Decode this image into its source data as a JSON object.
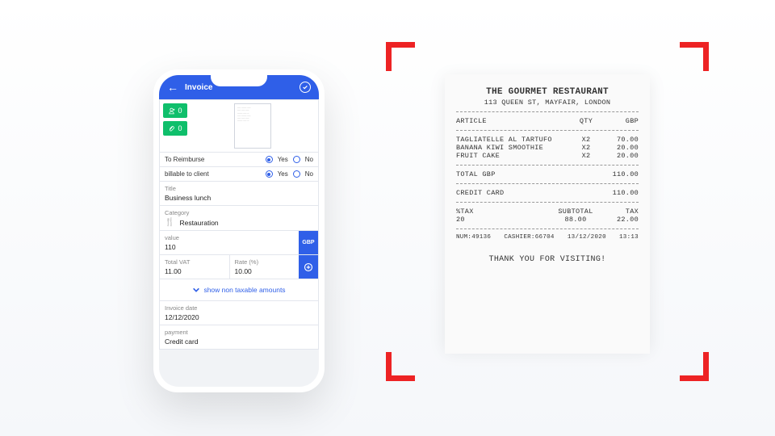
{
  "phone": {
    "header": {
      "title": "Invoice"
    },
    "counters": {
      "people": "0",
      "attachments": "0"
    },
    "reimburse": {
      "label": "To Reimburse",
      "yes": "Yes",
      "no": "No",
      "selected": "yes"
    },
    "billable": {
      "label": "billable to client",
      "yes": "Yes",
      "no": "No",
      "selected": "yes"
    },
    "title": {
      "label": "Title",
      "value": "Business lunch"
    },
    "category": {
      "label": "Category",
      "value": "Restauration"
    },
    "value": {
      "label": "value",
      "amount": "110",
      "currency": "GBP"
    },
    "vat": {
      "total_label": "Total VAT",
      "total_value": "11.00",
      "rate_label": "Rate (%)",
      "rate_value": "10.00"
    },
    "show_non_taxable": "show non taxable amounts",
    "invoice_date": {
      "label": "Invoice date",
      "value": "12/12/2020"
    },
    "payment": {
      "label": "payment",
      "value": "Credit card"
    }
  },
  "receipt": {
    "name": "THE GOURMET RESTAURANT",
    "address": "113 QUEEN ST, MAYFAIR, LONDON",
    "cols": {
      "article": "ARTICLE",
      "qty": "QTY",
      "cur": "GBP"
    },
    "items": [
      {
        "name": "TAGLIATELLE AL TARTUFO",
        "qty": "X2",
        "price": "70.00"
      },
      {
        "name": "BANANA KIWI SMOOTHIE",
        "qty": "X2",
        "price": "20.00"
      },
      {
        "name": "FRUIT CAKE",
        "qty": "X2",
        "price": "20.00"
      }
    ],
    "total": {
      "label": "TOTAL GBP",
      "value": "110.00"
    },
    "payment": {
      "label": "CREDIT CARD",
      "value": "110.00"
    },
    "tax": {
      "pct_label": "%TAX",
      "pct": "20",
      "sub_label": "SUBTOTAL",
      "sub": "88.00",
      "tax_label": "TAX",
      "tax": "22.00"
    },
    "meta": {
      "num": "NUM:49136",
      "cashier": "CASHIER:66704",
      "date": "13/12/2020",
      "time": "13:13"
    },
    "thanks": "THANK YOU FOR VISITING!"
  }
}
